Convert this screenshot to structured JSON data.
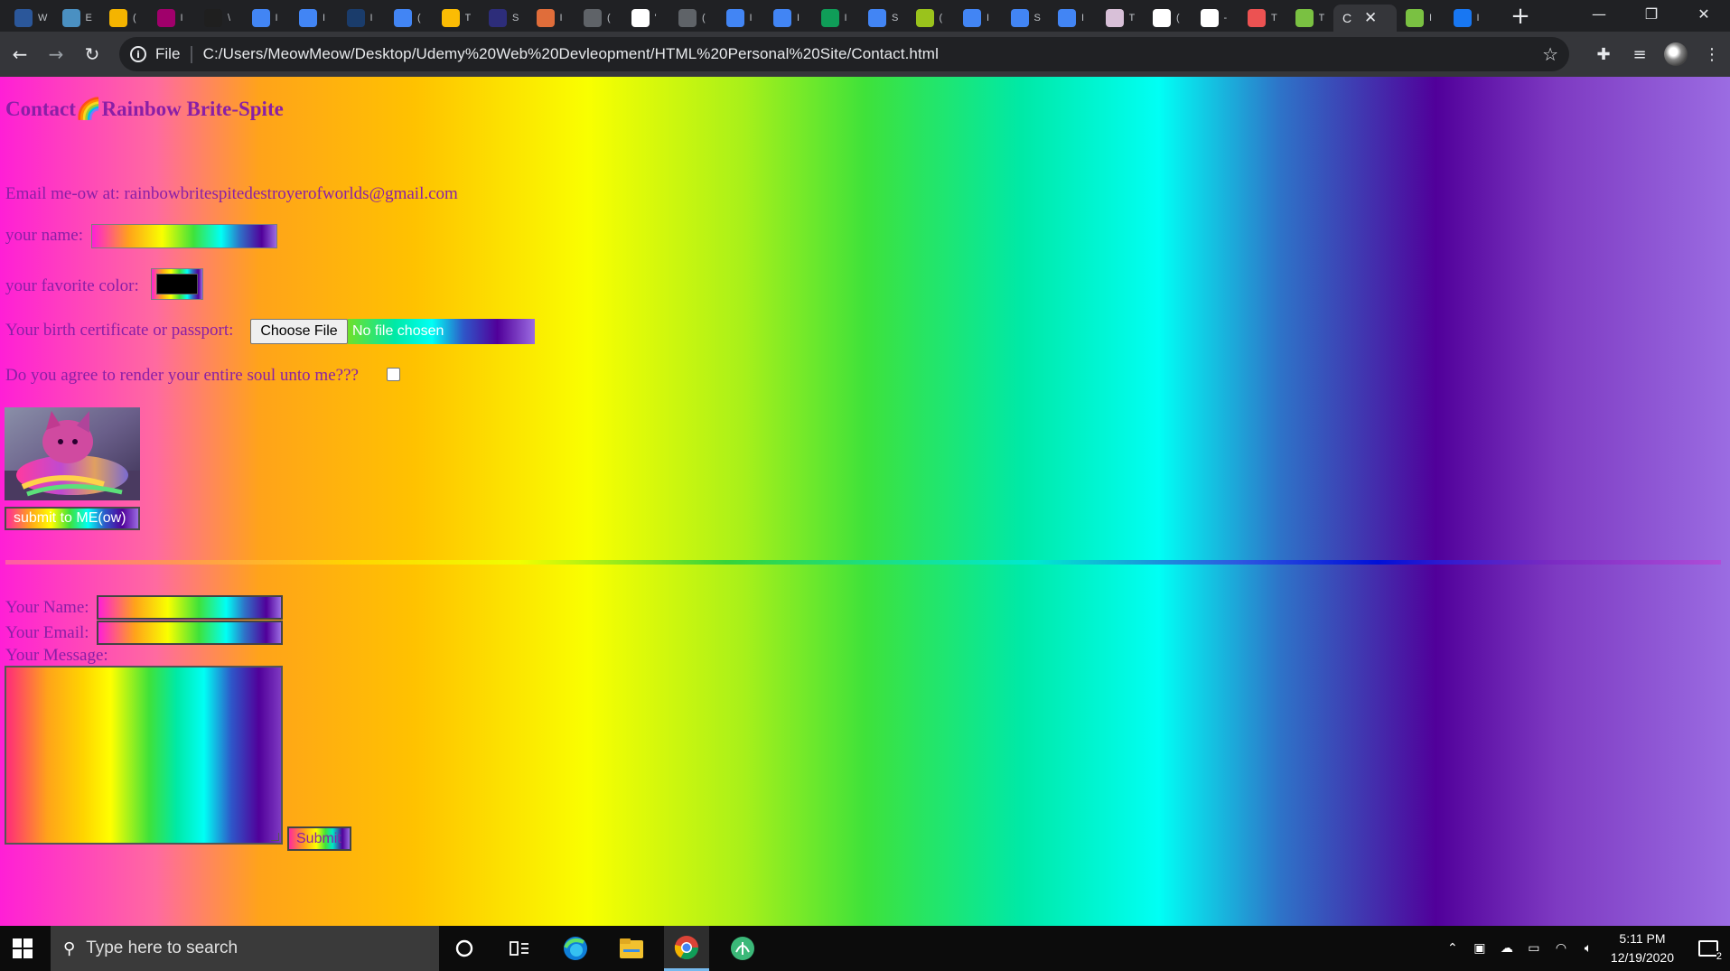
{
  "browser": {
    "tabs": [
      {
        "icon": "word-icon",
        "label": "W",
        "color": "#2b579a"
      },
      {
        "icon": "document-icon",
        "label": "E",
        "color": "#4a90c2"
      },
      {
        "icon": "grid-icon",
        "label": "(",
        "color": "#f4b400"
      },
      {
        "icon": "shield-icon",
        "label": "I",
        "color": "#a0006b"
      },
      {
        "icon": "info-icon",
        "label": "\\",
        "color": "#1f1f1f"
      },
      {
        "icon": "docs-icon",
        "label": "I",
        "color": "#4285f4"
      },
      {
        "icon": "docs-icon",
        "label": "I",
        "color": "#4285f4"
      },
      {
        "icon": "globe-icon",
        "label": "I",
        "color": "#1a3c6b"
      },
      {
        "icon": "docs-icon",
        "label": "(",
        "color": "#4285f4"
      },
      {
        "icon": "note-icon",
        "label": "T",
        "color": "#fbbc04"
      },
      {
        "icon": "star-icon",
        "label": "S",
        "color": "#2d2d7a"
      },
      {
        "icon": "flower-icon",
        "label": "I",
        "color": "#e06d3a"
      },
      {
        "icon": "globe-icon",
        "label": "(",
        "color": "#5f6368"
      },
      {
        "icon": "wiki-icon",
        "label": "'",
        "color": "#ffffff"
      },
      {
        "icon": "globe-icon",
        "label": "(",
        "color": "#5f6368"
      },
      {
        "icon": "docs-icon",
        "label": "I",
        "color": "#4285f4"
      },
      {
        "icon": "docs-icon",
        "label": "I",
        "color": "#4285f4"
      },
      {
        "icon": "sheets-icon",
        "label": "I",
        "color": "#0f9d58"
      },
      {
        "icon": "docs-icon",
        "label": "S",
        "color": "#4285f4"
      },
      {
        "icon": "circle-icon",
        "label": "(",
        "color": "#9ac31c"
      },
      {
        "icon": "docs-icon",
        "label": "I",
        "color": "#4285f4"
      },
      {
        "icon": "docs-icon",
        "label": "S",
        "color": "#4285f4"
      },
      {
        "icon": "docs-icon",
        "label": "I",
        "color": "#4285f4"
      },
      {
        "icon": "anime-icon",
        "label": "T",
        "color": "#d8c0d8"
      },
      {
        "icon": "codepen-icon",
        "label": "(",
        "color": "#ffffff"
      },
      {
        "icon": "graduation-cap-icon",
        "label": "-",
        "color": "#ffffff"
      },
      {
        "icon": "udemy-icon",
        "label": "T",
        "color": "#ec5252"
      },
      {
        "icon": "cash-icon",
        "label": "T",
        "color": "#7ac142"
      }
    ],
    "active_tab": {
      "label": "C",
      "close": "✕"
    },
    "after_tabs": [
      {
        "icon": "cash-icon",
        "label": "I",
        "color": "#7ac142"
      },
      {
        "icon": "facebook-icon",
        "label": "I",
        "color": "#1877f2"
      }
    ],
    "new_tab": "+",
    "window_controls": {
      "minimize": "—",
      "restore": "❐",
      "close": "✕"
    },
    "scheme": "File",
    "url": "C:/Users/MeowMeow/Desktop/Udemy%20Web%20Devleopment/HTML%20Personal%20Site/Contact.html"
  },
  "page": {
    "title": "Contact🌈Rainbow Brite-Spite",
    "email_line": "Email me-ow at: rainbowbritespitedestroyerofworlds@gmail.com",
    "name_label": "your name:",
    "color_label": "your favorite color:",
    "color_value": "#000000",
    "file_label": "Your birth certificate or passport:",
    "choose_file": "Choose File",
    "no_file": "No file chosen",
    "agree_label": "Do you agree to render your entire soul unto me???",
    "submit_image_label": "submit to ME(ow)",
    "form2": {
      "name_label": "Your Name:",
      "email_label": "Your Email:",
      "message_label": "Your Message:",
      "submit": "Submit"
    }
  },
  "taskbar": {
    "search_placeholder": "Type here to search",
    "time": "5:11 PM",
    "date": "12/19/2020",
    "notifications": "2"
  }
}
